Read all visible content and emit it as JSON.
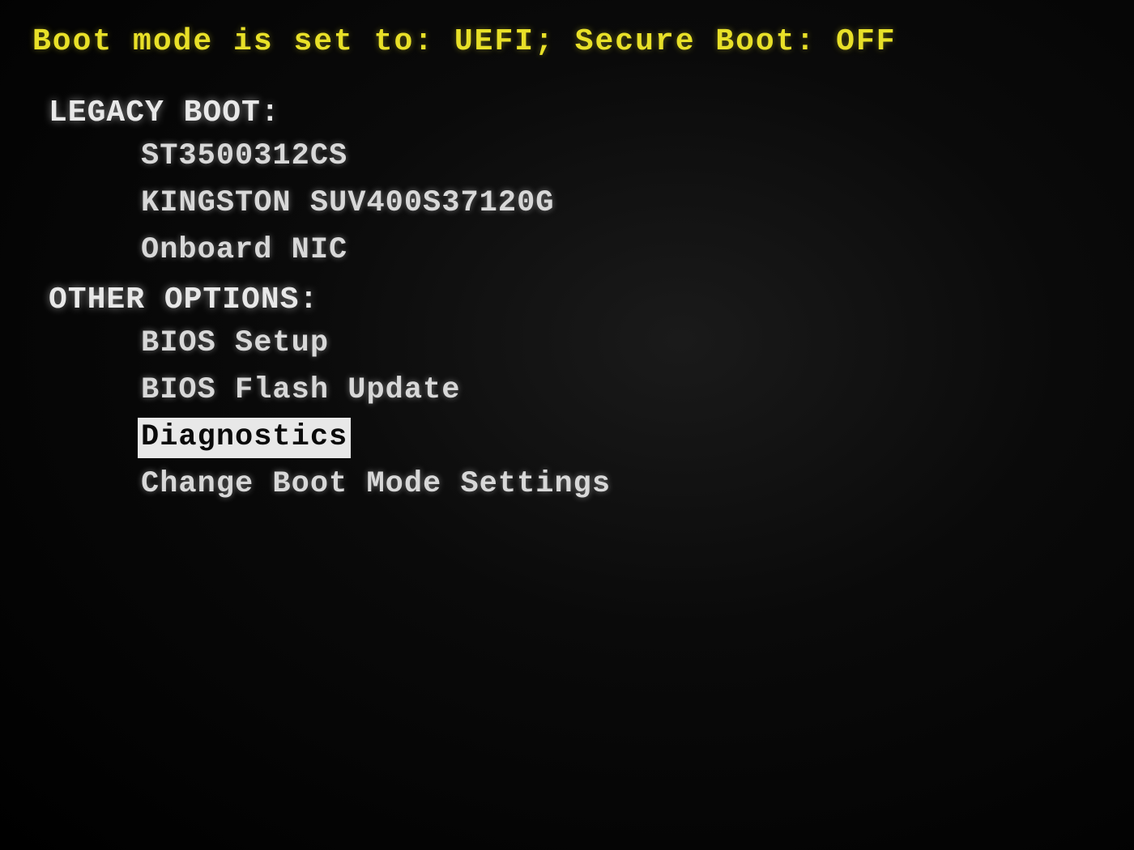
{
  "status_line": "Boot mode is set to: UEFI; Secure Boot: OFF",
  "sections": {
    "legacy": {
      "header": "LEGACY BOOT:",
      "items": [
        "ST3500312CS",
        "KINGSTON SUV400S37120G",
        "Onboard NIC"
      ]
    },
    "other": {
      "header": "OTHER OPTIONS:",
      "items": [
        "BIOS Setup",
        "BIOS Flash Update",
        "Diagnostics",
        "Change Boot Mode Settings"
      ]
    }
  },
  "selected_item": "Diagnostics"
}
